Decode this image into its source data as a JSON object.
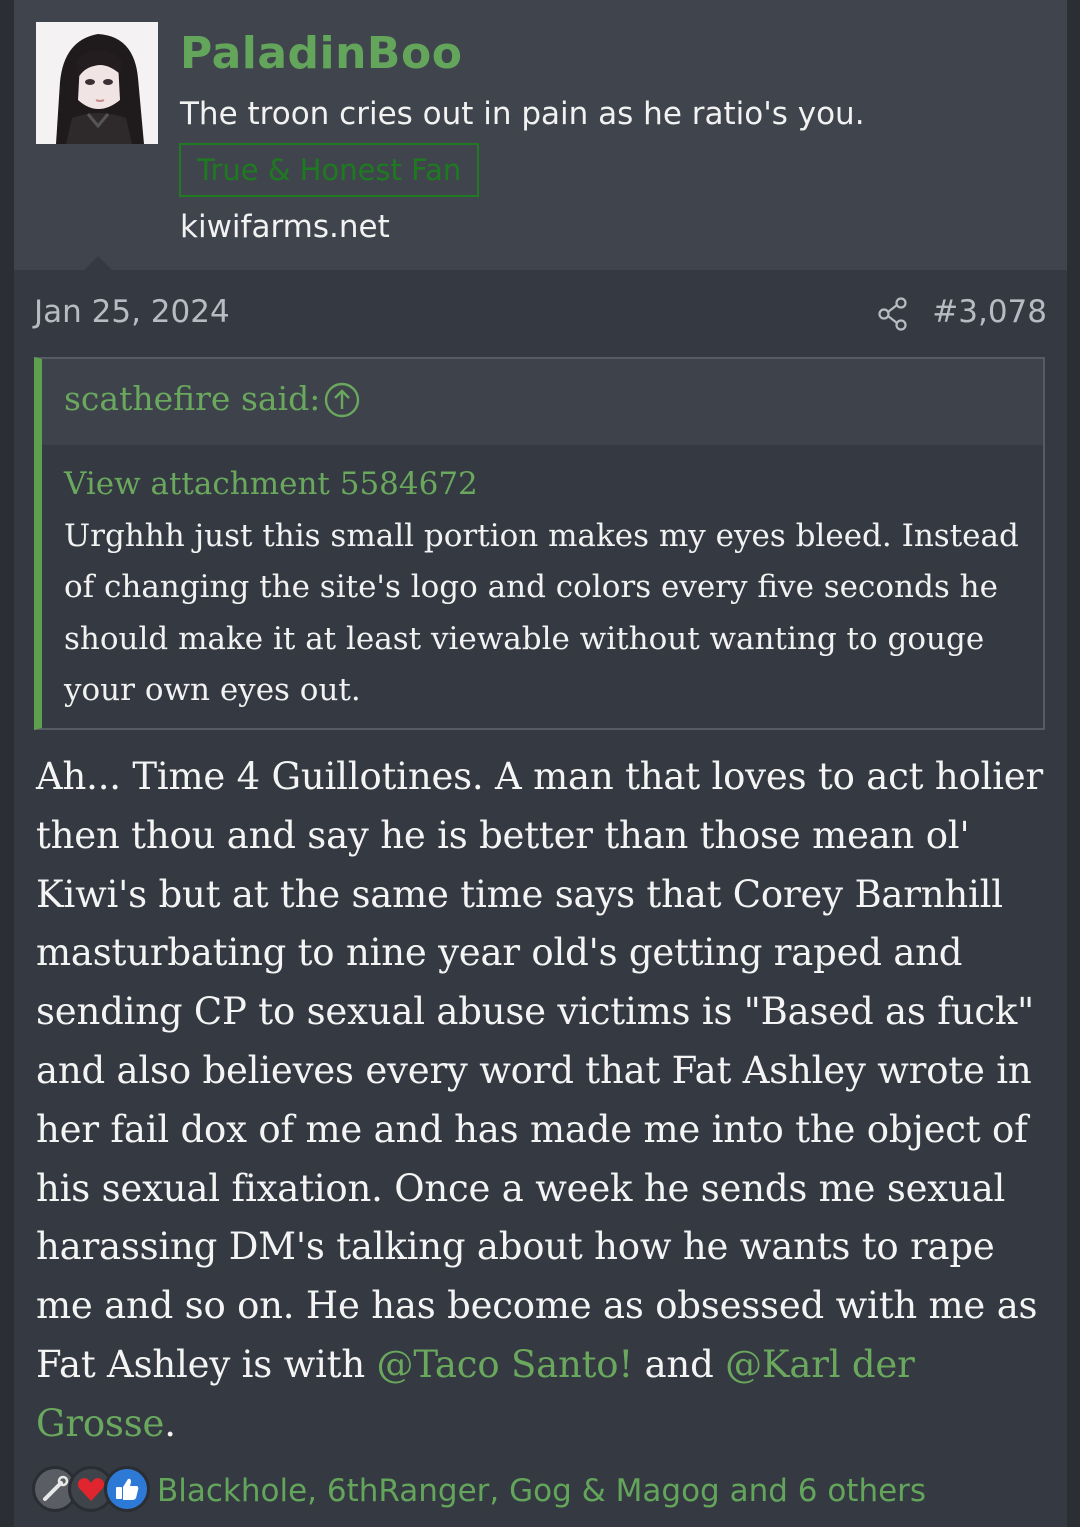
{
  "user": {
    "username": "PaladinBoo",
    "title": "The troon cries out in pain as he ratio's you.",
    "badge": "True & Honest Fan",
    "site": "kiwifarms.net"
  },
  "meta": {
    "date": "Jan 25, 2024",
    "post_number": "#3,078"
  },
  "quote": {
    "author": "scathefire said:",
    "attachment": "View attachment 5584672",
    "text": "Urghhh just this small portion makes my eyes bleed. Instead of changing the site's logo and colors every five seconds he should make it at least viewable without wanting to gouge your own eyes out."
  },
  "body": {
    "text_before": "Ah... Time 4 Guillotines. A man that loves to act holier then thou and say he is better than those mean ol' Kiwi's but at the same time says that Corey Barnhill masturbating to nine year old's getting raped and sending CP to sexual abuse victims is \"Based as fuck\" and also believes every word that Fat Ashley wrote in her fail dox of me and has made me into the object of his sexual fixation. Once a week he sends me sexual harassing DM's talking about how he wants to rape me and so on. He has become as obsessed with me as Fat Ashley is with ",
    "mention1": "@Taco Santo!",
    "connector": " and ",
    "mention2": "@Karl der Grosse",
    "end": "."
  },
  "reactions": {
    "icons": [
      "wrench-icon",
      "heart-icon",
      "thumbs-up-icon"
    ],
    "text": "Blackhole, 6thRanger, Gog & Magog and 6 others"
  },
  "colors": {
    "accent": "#63a55a",
    "badge": "#1e7a20",
    "background": "#353a42",
    "header": "#40454d"
  }
}
